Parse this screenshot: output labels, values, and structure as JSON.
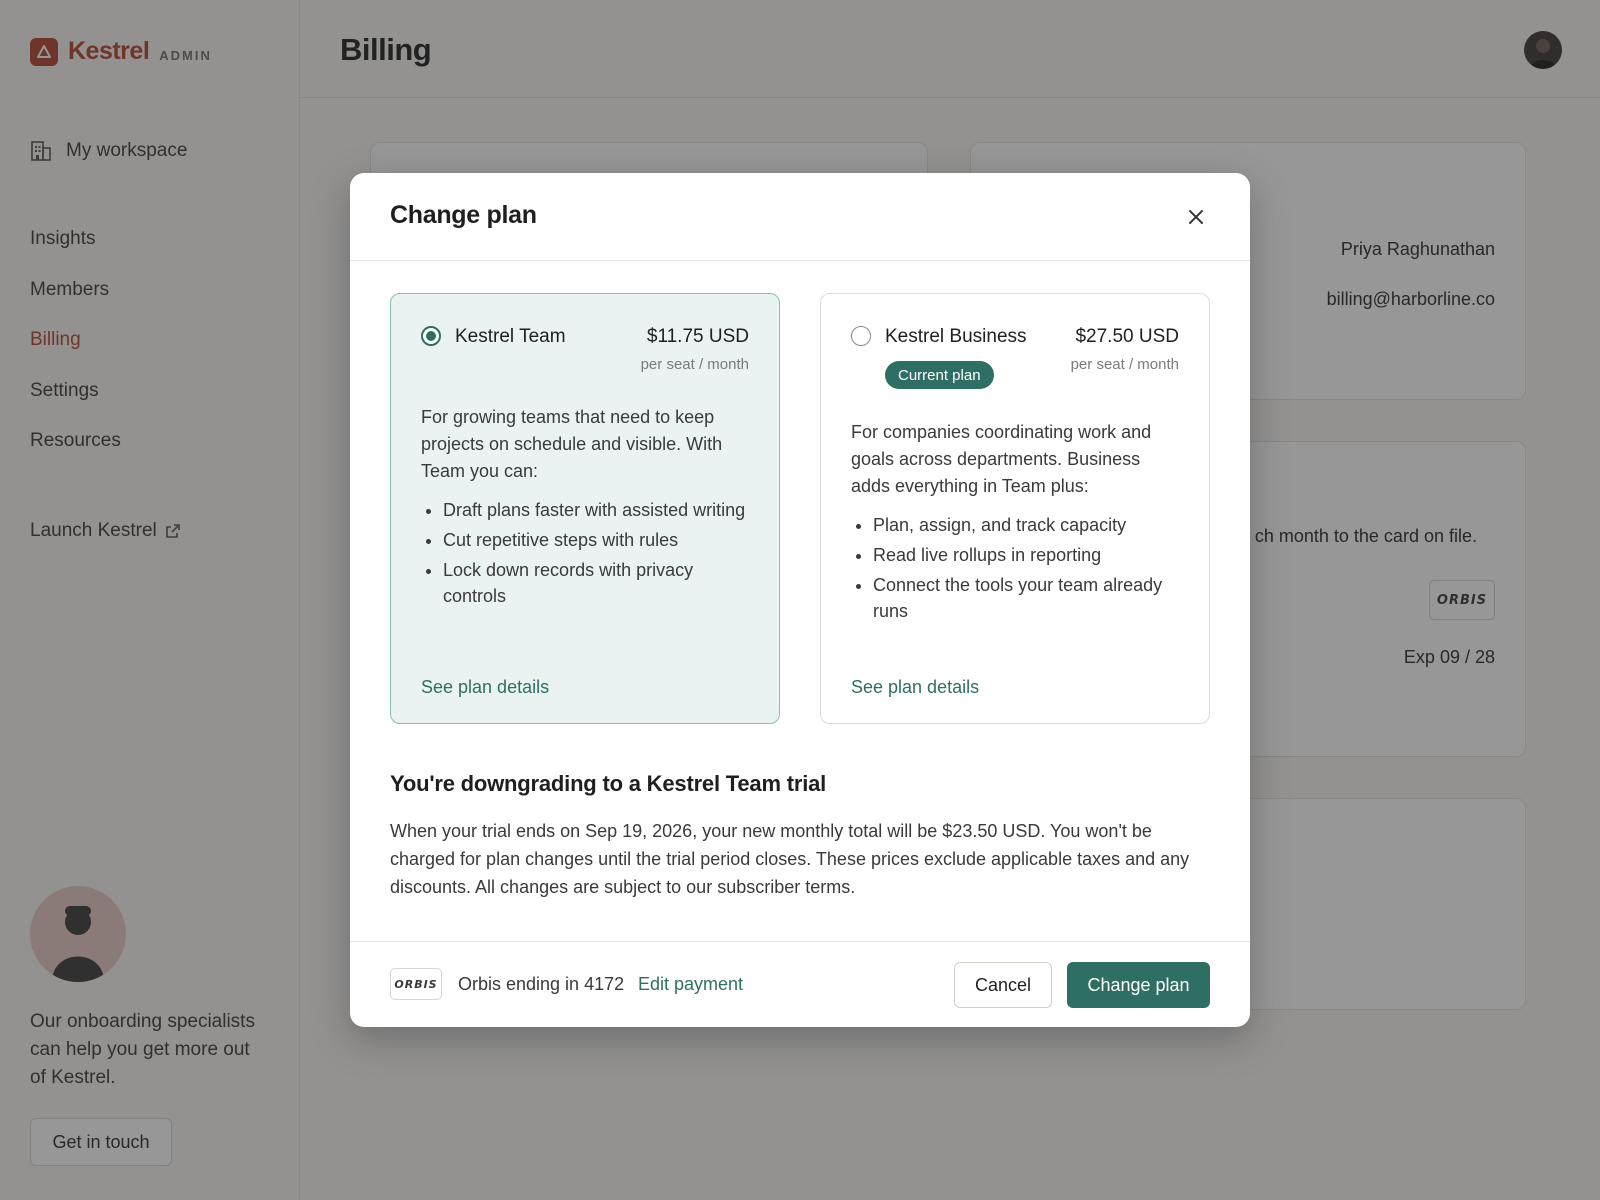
{
  "app": {
    "name": "Kestrel",
    "tag": "ADMIN",
    "accent": "#b5432e",
    "primary": "#2f6f63"
  },
  "sidebar": {
    "workspace": "My workspace",
    "items": [
      {
        "label": "Insights"
      },
      {
        "label": "Members"
      },
      {
        "label": "Billing",
        "active": true
      },
      {
        "label": "Settings"
      },
      {
        "label": "Resources"
      }
    ],
    "launch": "Launch Kestrel",
    "helper_text": "Our onboarding specialists can help you get more out of Kestrel.",
    "helper_button": "Get in touch"
  },
  "header": {
    "title": "Billing"
  },
  "background": {
    "contact_name": "Priya Raghunathan",
    "contact_email": "billing@harborline.co",
    "payment_note": "ch month to the card on file.",
    "card_brand": "ORBIS",
    "card_exp": "Exp 09 / 28"
  },
  "modal": {
    "title": "Change plan",
    "plans": [
      {
        "name": "Kestrel Team",
        "price": "$11.75 USD",
        "per": "per seat / month",
        "selected": true,
        "description": "For growing teams that need to keep projects on schedule and visible. With Team you can:",
        "features": [
          "Draft plans faster with assisted writing",
          "Cut repetitive steps with rules",
          "Lock down records with privacy controls"
        ],
        "link": "See plan details"
      },
      {
        "name": "Kestrel Business",
        "price": "$27.50 USD",
        "per": "per seat / month",
        "selected": false,
        "badge": "Current plan",
        "description": "For companies coordinating work and goals across departments. Business adds everything in Team plus:",
        "features": [
          "Plan, assign, and track capacity",
          "Read live rollups in reporting",
          "Connect the tools your team already runs"
        ],
        "link": "See plan details"
      }
    ],
    "downgrade_title": "You're downgrading to a Kestrel Team trial",
    "downgrade_text": "When your trial ends on Sep 19, 2026, your new monthly total will be $23.50 USD. You won't be charged for plan changes until the trial period closes. These prices exclude applicable taxes and any discounts. All changes are subject to our subscriber terms.",
    "footer": {
      "card_brand": "ORBIS",
      "card_text": "Orbis ending in 4172",
      "edit": "Edit payment",
      "cancel": "Cancel",
      "confirm": "Change plan"
    }
  }
}
